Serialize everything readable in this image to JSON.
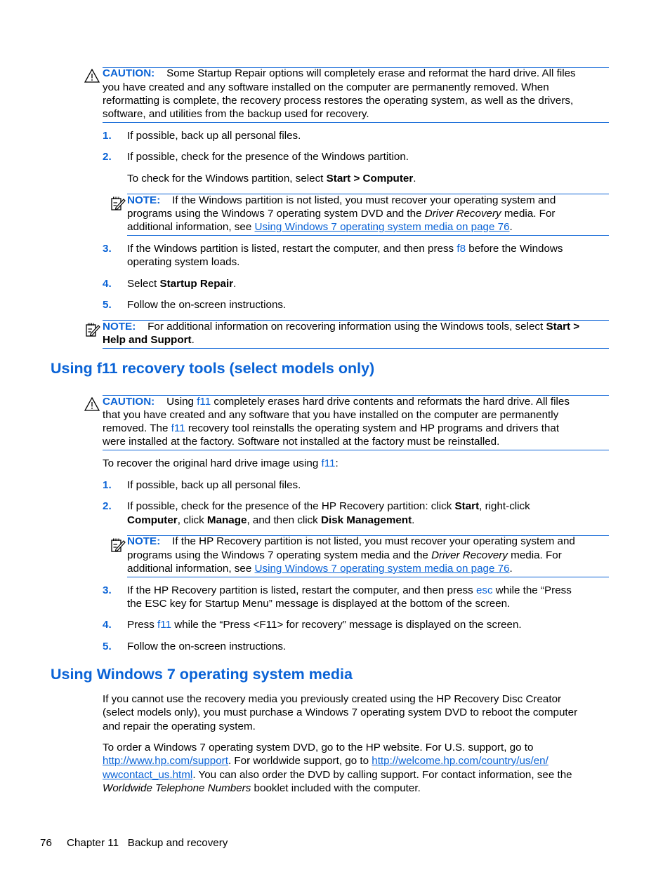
{
  "colors": {
    "accent": "#0a63d6",
    "text": "#000000",
    "background": "#ffffff"
  },
  "icons": {
    "caution": "caution-triangle-icon",
    "note": "note-pencil-icon"
  },
  "caution1": {
    "label": "CAUTION:",
    "lines": [
      "Some Startup Repair options will completely erase and reformat the hard drive. All files",
      "you have created and any software installed on the computer are permanently removed. When",
      "reformatting is complete, the recovery process restores the operating system, as well as the drivers,",
      "software, and utilities from the backup used for recovery."
    ]
  },
  "steps1": [
    {
      "num": "1.",
      "text": "If possible, back up all personal files."
    },
    {
      "num": "2.",
      "text": "If possible, check for the presence of the Windows partition."
    }
  ],
  "step2_sub": {
    "pre": "To check for the Windows partition, select ",
    "bold": "Start > Computer",
    "post": "."
  },
  "note1": {
    "label": "NOTE:",
    "line1": "If the Windows partition is not listed, you must recover your operating system and",
    "line2_pre": "programs using the Windows 7 operating system DVD and the ",
    "line2_italic": "Driver Recovery",
    "line2_post": " media. For",
    "line3_pre": "additional information, see ",
    "line3_link": "Using Windows 7 operating system media on page 76",
    "line3_post": "."
  },
  "steps1b": {
    "s3": {
      "num": "3.",
      "pre": "If the Windows partition is listed, restart the computer, and then press ",
      "key": "f8",
      "post": " before the Windows",
      "line2": "operating system loads."
    },
    "s4": {
      "num": "4.",
      "pre": "Select ",
      "bold": "Startup Repair",
      "post": "."
    },
    "s5": {
      "num": "5.",
      "text": "Follow the on-screen instructions."
    }
  },
  "note2": {
    "label": "NOTE:",
    "line1_pre": "For additional information on recovering information using the Windows tools, select ",
    "line1_bold": "Start >",
    "line2_bold": "Help and Support",
    "line2_post": "."
  },
  "heading1": "Using f11 recovery tools (select models only)",
  "caution2": {
    "label": "CAUTION:",
    "l1_pre": "Using ",
    "l1_key": "f11",
    "l1_post": " completely erases hard drive contents and reformats the hard drive. All files",
    "l2": "that you have created and any software that you have installed on the computer are permanently",
    "l3_pre": "removed. The ",
    "l3_key": "f11",
    "l3_post": " recovery tool reinstalls the operating system and HP programs and drivers that",
    "l4": "were installed at the factory. Software not installed at the factory must be reinstalled."
  },
  "intro2": {
    "pre": "To recover the original hard drive image using ",
    "key": "f11",
    "post": ":"
  },
  "steps2": {
    "s1": {
      "num": "1.",
      "text": "If possible, back up all personal files."
    },
    "s2": {
      "num": "2.",
      "l1_pre": "If possible, check for the presence of the HP Recovery partition: click ",
      "l1_b1": "Start",
      "l1_post": ", right-click",
      "l2_b1": "Computer",
      "l2_m1": ", click ",
      "l2_b2": "Manage",
      "l2_m2": ", and then click ",
      "l2_b3": "Disk Management",
      "l2_post": "."
    },
    "s3": {
      "num": "3.",
      "pre": "If the HP Recovery partition is listed, restart the computer, and then press ",
      "key": "esc",
      "post": " while the “Press",
      "line2": "the ESC key for Startup Menu” message is displayed at the bottom of the screen."
    },
    "s4": {
      "num": "4.",
      "pre": "Press ",
      "key": "f11",
      "post": " while the “Press <F11> for recovery” message is displayed on the screen."
    },
    "s5": {
      "num": "5.",
      "text": "Follow the on-screen instructions."
    }
  },
  "note3": {
    "label": "NOTE:",
    "line1": "If the HP Recovery partition is not listed, you must recover your operating system and",
    "line2_pre": "programs using the Windows 7 operating system media and the ",
    "line2_italic": "Driver Recovery",
    "line2_post": " media. For",
    "line3_pre": "additional information, see ",
    "line3_link": "Using Windows 7 operating system media on page 76",
    "line3_post": "."
  },
  "heading2": "Using Windows 7 operating system media",
  "para1": [
    "If you cannot use the recovery media you previously created using the HP Recovery Disc Creator",
    "(select models only), you must purchase a Windows 7 operating system DVD to reboot the computer",
    "and repair the operating system."
  ],
  "para2": {
    "l1": "To order a Windows 7 operating system DVD, go to the HP website. For U.S. support, go to",
    "l2_link1": "http://www.hp.com/support",
    "l2_mid": ". For worldwide support, go to ",
    "l2_link2": "http://welcome.hp.com/country/us/en/",
    "l3_link": "wwcontact_us.html",
    "l3_post": ". You can also order the DVD by calling support. For contact information, see the",
    "l4_italic": "Worldwide Telephone Numbers",
    "l4_post": " booklet included with the computer."
  },
  "footer": {
    "page_number": "76",
    "chapter": "Chapter 11",
    "title": "Backup and recovery"
  }
}
